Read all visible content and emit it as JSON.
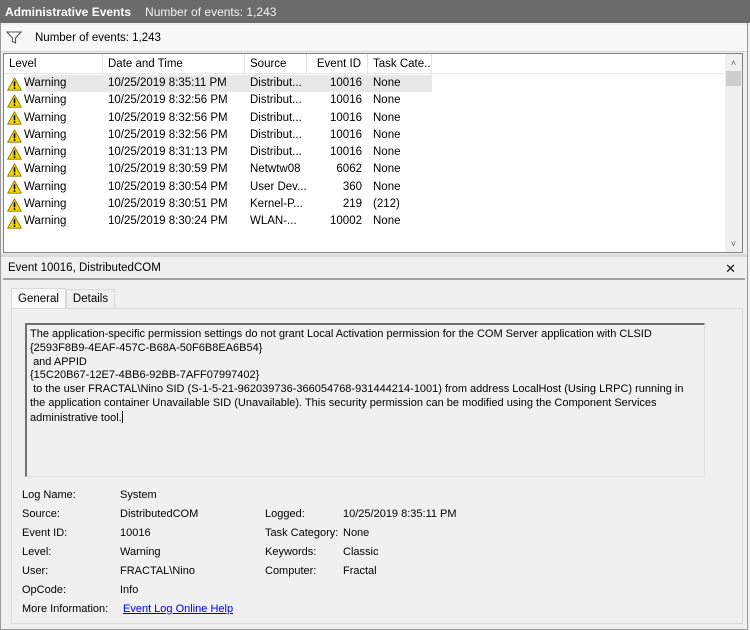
{
  "title_bar": {
    "title": "Administrative Events",
    "count": "Number of events: 1,243"
  },
  "filter_bar": {
    "icon": "filter-icon",
    "text": "Number of events: 1,243"
  },
  "grid": {
    "columns": [
      "Level",
      "Date and Time",
      "Source",
      "Event ID",
      "Task Cate..."
    ],
    "rows": [
      {
        "level": "Warning",
        "date": "10/25/2019 8:35:11 PM",
        "source": "Distribut...",
        "event_id": "10016",
        "task": "None",
        "selected": true
      },
      {
        "level": "Warning",
        "date": "10/25/2019 8:32:56 PM",
        "source": "Distribut...",
        "event_id": "10016",
        "task": "None"
      },
      {
        "level": "Warning",
        "date": "10/25/2019 8:32:56 PM",
        "source": "Distribut...",
        "event_id": "10016",
        "task": "None"
      },
      {
        "level": "Warning",
        "date": "10/25/2019 8:32:56 PM",
        "source": "Distribut...",
        "event_id": "10016",
        "task": "None"
      },
      {
        "level": "Warning",
        "date": "10/25/2019 8:31:13 PM",
        "source": "Distribut...",
        "event_id": "10016",
        "task": "None"
      },
      {
        "level": "Warning",
        "date": "10/25/2019 8:30:59 PM",
        "source": "Netwtw08",
        "event_id": "6062",
        "task": "None"
      },
      {
        "level": "Warning",
        "date": "10/25/2019 8:30:54 PM",
        "source": "User Dev...",
        "event_id": "360",
        "task": "None"
      },
      {
        "level": "Warning",
        "date": "10/25/2019 8:30:51 PM",
        "source": "Kernel-P...",
        "event_id": "219",
        "task": "(212)"
      },
      {
        "level": "Warning",
        "date": "10/25/2019 8:30:24 PM",
        "source": "WLAN-...",
        "event_id": "10002",
        "task": "None"
      }
    ],
    "scroll_up": "˄",
    "scroll_down": "˅"
  },
  "detail": {
    "header": "Event 10016, DistributedCOM",
    "close": "✕",
    "tabs": [
      {
        "label": "General",
        "active": true
      },
      {
        "label": "Details",
        "active": false
      }
    ],
    "message": "The application-specific permission settings do not grant Local Activation permission for the COM Server application with CLSID\n{2593F8B9-4EAF-457C-B68A-50F6B8EA6B54}\n and APPID\n{15C20B67-12E7-4BB6-92BB-7AFF07997402}\n to the user FRACTAL\\Nino SID (S-1-5-21-962039736-366054768-931444214-1001) from address LocalHost (Using LRPC) running in the application container Unavailable SID (Unavailable). This security permission can be modified using the Component Services administrative tool.",
    "properties": {
      "log_name_label": "Log Name:",
      "log_name": "System",
      "source_label": "Source:",
      "source": "DistributedCOM",
      "logged_label": "Logged:",
      "logged": "10/25/2019 8:35:11 PM",
      "event_id_label": "Event ID:",
      "event_id": "10016",
      "task_category_label": "Task Category:",
      "task_category": "None",
      "level_label": "Level:",
      "level": "Warning",
      "keywords_label": "Keywords:",
      "keywords": "Classic",
      "user_label": "User:",
      "user": "FRACTAL\\Nino",
      "computer_label": "Computer:",
      "computer": "Fractal",
      "opcode_label": "OpCode:",
      "opcode": "Info",
      "more_info_label": "More Information:",
      "more_info_link": "Event Log Online Help"
    }
  },
  "colors": {
    "title_bar_bg": "#6b6b6b",
    "selected_row_bg": "#e8e8e8",
    "warning_yellow": "#f5d800",
    "link": "#0000ee"
  }
}
